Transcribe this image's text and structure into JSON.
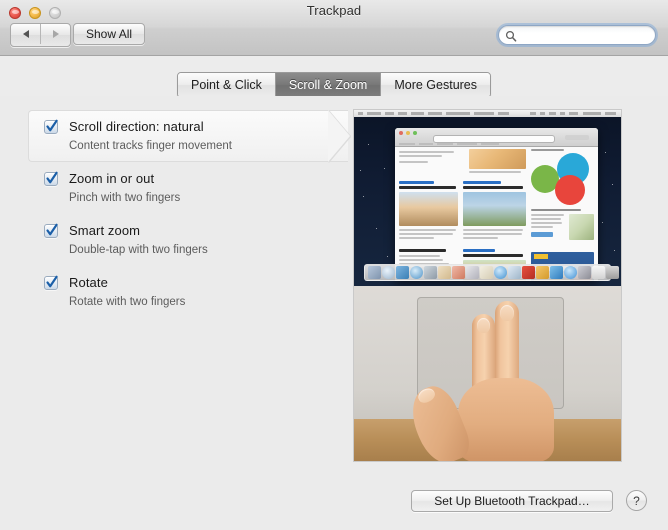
{
  "window": {
    "title": "Trackpad",
    "traffic_lights": [
      {
        "name": "close",
        "color": "#ee5f56"
      },
      {
        "name": "minimize",
        "color": "#f6bd4f"
      },
      {
        "name": "zoom",
        "color": "#d6d6d6"
      }
    ]
  },
  "toolbar": {
    "back_label": "Back",
    "forward_label": "Forward",
    "show_all_label": "Show All",
    "search": {
      "value": "",
      "placeholder": "",
      "icon": "search-icon"
    }
  },
  "tabs": [
    {
      "label": "Point & Click",
      "active": false
    },
    {
      "label": "Scroll & Zoom",
      "active": true
    },
    {
      "label": "More Gestures",
      "active": false
    }
  ],
  "options": [
    {
      "title": "Scroll direction: natural",
      "subtitle": "Content tracks finger movement",
      "checked": true,
      "selected": true
    },
    {
      "title": "Zoom in or out",
      "subtitle": "Pinch with two fingers",
      "checked": true,
      "selected": false
    },
    {
      "title": "Smart zoom",
      "subtitle": "Double-tap with two fingers",
      "checked": true,
      "selected": false
    },
    {
      "title": "Rotate",
      "subtitle": "Rotate with two fingers",
      "checked": true,
      "selected": false
    }
  ],
  "preview": {
    "top_description": "Mac desktop showing a Safari browser window with a travel website on a dark starry wallpaper, with the Dock at the bottom",
    "bottom_description": "Photograph of a hand resting two fingers on a MacBook trackpad"
  },
  "footer": {
    "setup_button_label": "Set Up Bluetooth Trackpad…",
    "help_button_label": "?"
  },
  "colors": {
    "accent_selected_tab": "#797979",
    "checkbox_check": "#1b5fa8",
    "window_background": "#ebebeb",
    "titlebar_background": "#d6d6d6",
    "search_focus_ring": "#76a3d9"
  }
}
